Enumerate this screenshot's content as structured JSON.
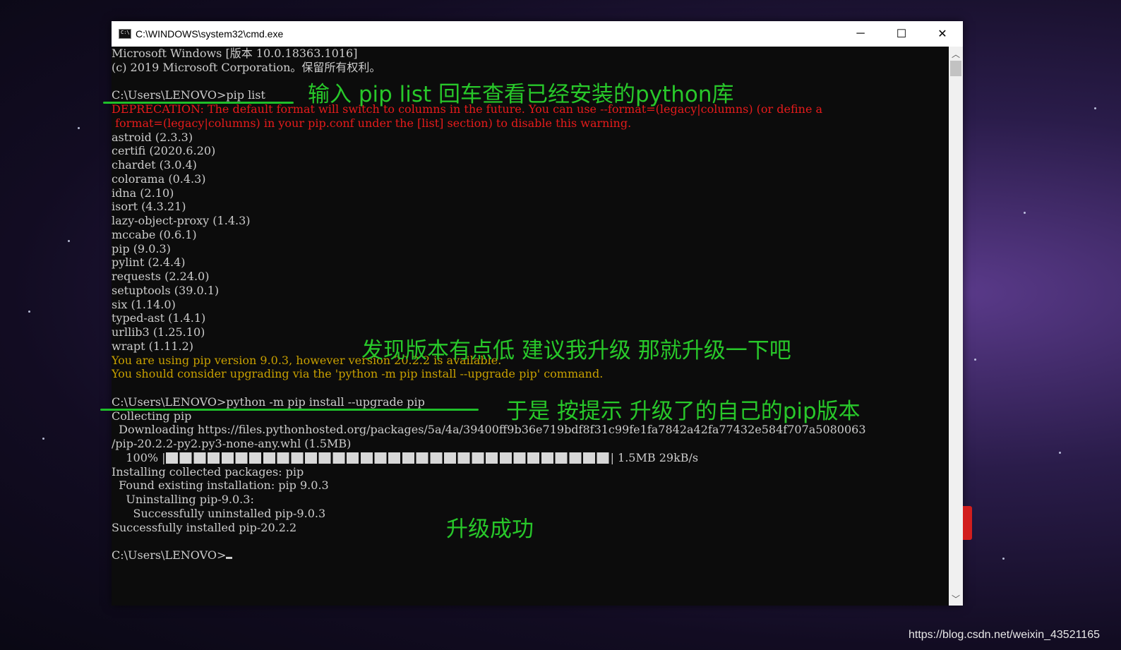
{
  "window": {
    "title": "C:\\WINDOWS\\system32\\cmd.exe",
    "buttons": [
      "─",
      "☐",
      "✕"
    ]
  },
  "console": {
    "lines": [
      {
        "text": "Microsoft Windows [版本 10.0.18363.1016]",
        "color": "default"
      },
      {
        "text": "(c) 2019 Microsoft Corporation。保留所有权利。",
        "color": "default"
      },
      {
        "text": "",
        "color": "default"
      },
      {
        "text": "C:\\Users\\LENOVO>pip list",
        "color": "default"
      },
      {
        "text": "DEPRECATION: The default format will switch to columns in the future. You can use --format=(legacy|columns) (or define a",
        "color": "red"
      },
      {
        "text": " format=(legacy|columns) in your pip.conf under the [list] section) to disable this warning.",
        "color": "red"
      },
      {
        "text": "astroid (2.3.3)",
        "color": "default"
      },
      {
        "text": "certifi (2020.6.20)",
        "color": "default"
      },
      {
        "text": "chardet (3.0.4)",
        "color": "default"
      },
      {
        "text": "colorama (0.4.3)",
        "color": "default"
      },
      {
        "text": "idna (2.10)",
        "color": "default"
      },
      {
        "text": "isort (4.3.21)",
        "color": "default"
      },
      {
        "text": "lazy-object-proxy (1.4.3)",
        "color": "default"
      },
      {
        "text": "mccabe (0.6.1)",
        "color": "default"
      },
      {
        "text": "pip (9.0.3)",
        "color": "default"
      },
      {
        "text": "pylint (2.4.4)",
        "color": "default"
      },
      {
        "text": "requests (2.24.0)",
        "color": "default"
      },
      {
        "text": "setuptools (39.0.1)",
        "color": "default"
      },
      {
        "text": "six (1.14.0)",
        "color": "default"
      },
      {
        "text": "typed-ast (1.4.1)",
        "color": "default"
      },
      {
        "text": "urllib3 (1.25.10)",
        "color": "default"
      },
      {
        "text": "wrapt (1.11.2)",
        "color": "default"
      },
      {
        "text": "You are using pip version 9.0.3, however version 20.2.2 is available.",
        "color": "yellow"
      },
      {
        "text": "You should consider upgrading via the 'python -m pip install --upgrade pip' command.",
        "color": "yellow"
      },
      {
        "text": "",
        "color": "default"
      },
      {
        "text": "C:\\Users\\LENOVO>python -m pip install --upgrade pip",
        "color": "default"
      },
      {
        "text": "Collecting pip",
        "color": "default"
      },
      {
        "text": "  Downloading https://files.pythonhosted.org/packages/5a/4a/39400ff9b36e719bdf8f31c99fe1fa7842a42fa77432e584f707a5080063",
        "color": "default"
      },
      {
        "text": "/pip-20.2.2-py2.py3-none-any.whl (1.5MB)",
        "color": "default"
      }
    ],
    "progress": {
      "percent_label": "    100% |",
      "fraction": 1.0,
      "speed": "| 1.5MB 29kB/s"
    },
    "lines_after": [
      {
        "text": "Installing collected packages: pip",
        "color": "default"
      },
      {
        "text": "  Found existing installation: pip 9.0.3",
        "color": "default"
      },
      {
        "text": "    Uninstalling pip-9.0.3:",
        "color": "default"
      },
      {
        "text": "      Successfully uninstalled pip-9.0.3",
        "color": "default"
      },
      {
        "text": "Successfully installed pip-20.2.2",
        "color": "default"
      },
      {
        "text": "",
        "color": "default"
      }
    ],
    "prompt": "C:\\Users\\LENOVO>"
  },
  "annotations": {
    "pip_list_note": "输入 pip list 回车查看已经安装的python库",
    "version_low_note": "发现版本有点低  建议我升级  那就升级一下吧",
    "upgrade_note": "于是 按提示 升级了的自己的pip版本",
    "success_note": "升级成功"
  },
  "watermark": "https://blog.csdn.net/weixin_43521165",
  "colors": {
    "default": "#cccccc",
    "red": "#e61b1b",
    "yellow": "#c8a000",
    "annotation": "#28c82a"
  }
}
